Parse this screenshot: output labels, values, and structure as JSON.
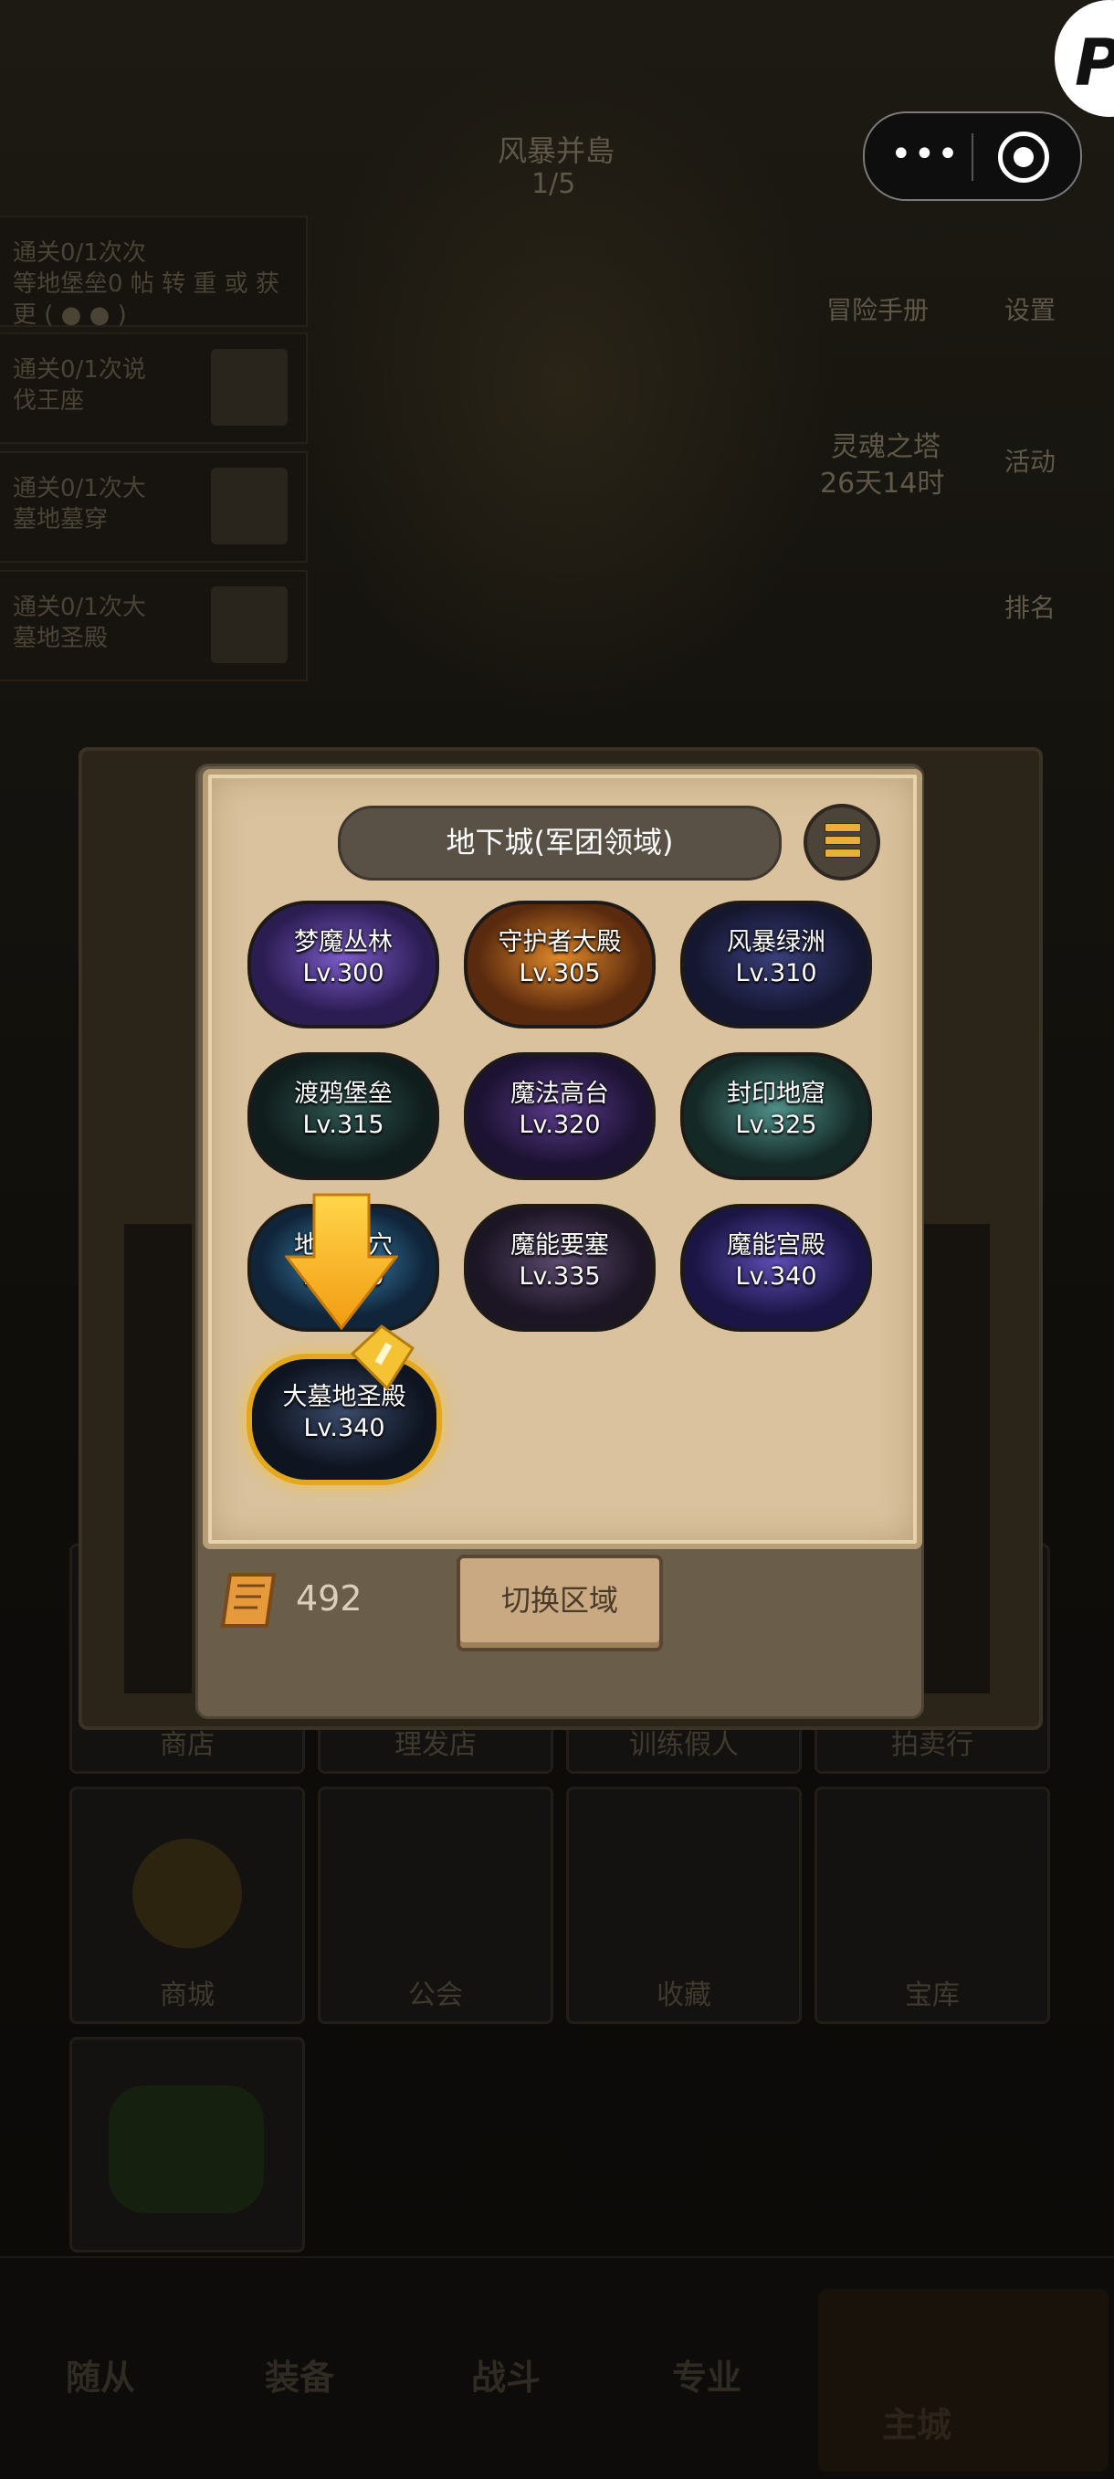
{
  "background": {
    "stage_title": "风暴并島",
    "stage_progress": "1/5",
    "tasks": [
      {
        "line1": "通关0/1次次",
        "line2": "等地堡垒0 帖 转 重 或 获 更 ( ● ● )"
      },
      {
        "line1": "通关0/1次说",
        "line2": "伐王座"
      },
      {
        "line1": "通关0/1次大",
        "line2": "墓地墓穿"
      },
      {
        "line1": "通关0/1次大",
        "line2": "墓地圣殿"
      }
    ],
    "right_items": [
      {
        "label": "冒险手册",
        "icon": "book-icon"
      },
      {
        "label": "设置",
        "icon": "gear-icon"
      },
      {
        "label": "活动",
        "icon": "gift-icon"
      },
      {
        "label": "排名",
        "icon": "trophy-icon"
      }
    ],
    "event_name": "灵魂之塔",
    "event_timer": "26天14时",
    "grid_row1": [
      "商店",
      "理发店",
      "训练假人",
      "拍卖行"
    ],
    "grid_row2": [
      "商城",
      "公会",
      "收藏",
      "宝库"
    ],
    "tabs": [
      "随从",
      "装备",
      "战斗",
      "专业",
      "主城"
    ]
  },
  "dialog": {
    "title": "地下城(军团领域)",
    "dungeons": [
      {
        "name": "梦魔丛林",
        "level": "Lv.300",
        "c1": "#7b5bc8",
        "c2": "#2b1c52"
      },
      {
        "name": "守护者大殿",
        "level": "Lv.305",
        "c1": "#e0892a",
        "c2": "#5a2a0e"
      },
      {
        "name": "风暴绿洲",
        "level": "Lv.310",
        "c1": "#3a3f7a",
        "c2": "#151731"
      },
      {
        "name": "渡鸦堡垒",
        "level": "Lv.315",
        "c1": "#2f5450",
        "c2": "#0f1d1c"
      },
      {
        "name": "魔法高台",
        "level": "Lv.320",
        "c1": "#5a3a8a",
        "c2": "#1c1232"
      },
      {
        "name": "封印地窟",
        "level": "Lv.325",
        "c1": "#4f8f88",
        "c2": "#142826"
      },
      {
        "name": "地狱裂穴",
        "level": "Lv.330",
        "c1": "#3f8ab3",
        "c2": "#10253a"
      },
      {
        "name": "魔能要塞",
        "level": "Lv.335",
        "c1": "#5b4a6e",
        "c2": "#1c1524"
      },
      {
        "name": "魔能宫殿",
        "level": "Lv.340",
        "c1": "#5d4cb3",
        "c2": "#1b1545"
      },
      {
        "name": "大墓地圣殿",
        "level": "Lv.340",
        "c1": "#3a4a6a",
        "c2": "#0e1420"
      }
    ],
    "currency_amount": "492",
    "switch_label": "切换区域"
  },
  "topbar": {
    "more_glyph": "•••",
    "logo_letter": "P"
  }
}
